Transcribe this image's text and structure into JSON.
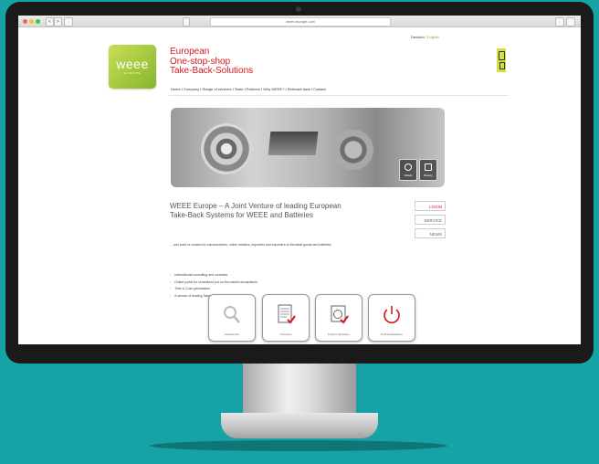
{
  "browser": {
    "url": "weee-europe.com",
    "nav_labels": [
      "<",
      ">"
    ]
  },
  "header": {
    "lang_de": "Deutsch",
    "lang_sep": "|",
    "lang_en": "English",
    "logo_text": "weee",
    "logo_sub": "EUROPE",
    "tagline": [
      "European",
      "One-stop-shop",
      "Take-Back-Solutions"
    ],
    "nav": "Home I Company I Range of services I Team I Partners I Why WEEE? I Relevant laws I Contact"
  },
  "hero": {
    "buttons": [
      "WEEE",
      "Battery"
    ]
  },
  "main": {
    "headline": "WEEE Europe – A Joint Venture of leading European Take-Back Systems for WEEE and Batteries",
    "intro": "... and point of contact for manufacturers, online retailers, importers and exporters of electrical goods and batteries",
    "bullets": [
      "International consulting and contracts",
      "Online portal for centralized put on the market declarations",
      "Time & Cost optimization",
      "A service of leading Take-Back Systems in Europe"
    ]
  },
  "sidebar": {
    "login": "LOGIN",
    "service": "SERVICE",
    "news": "NEWS"
  },
  "cards": [
    {
      "label": "Assessment"
    },
    {
      "label": "Contracts"
    },
    {
      "label": "Product Allocation"
    },
    {
      "label": "PoM Declarations"
    }
  ],
  "colors": {
    "background": "#17a3a5",
    "accent_red": "#d4181f",
    "brand_green": "#86b62d"
  }
}
